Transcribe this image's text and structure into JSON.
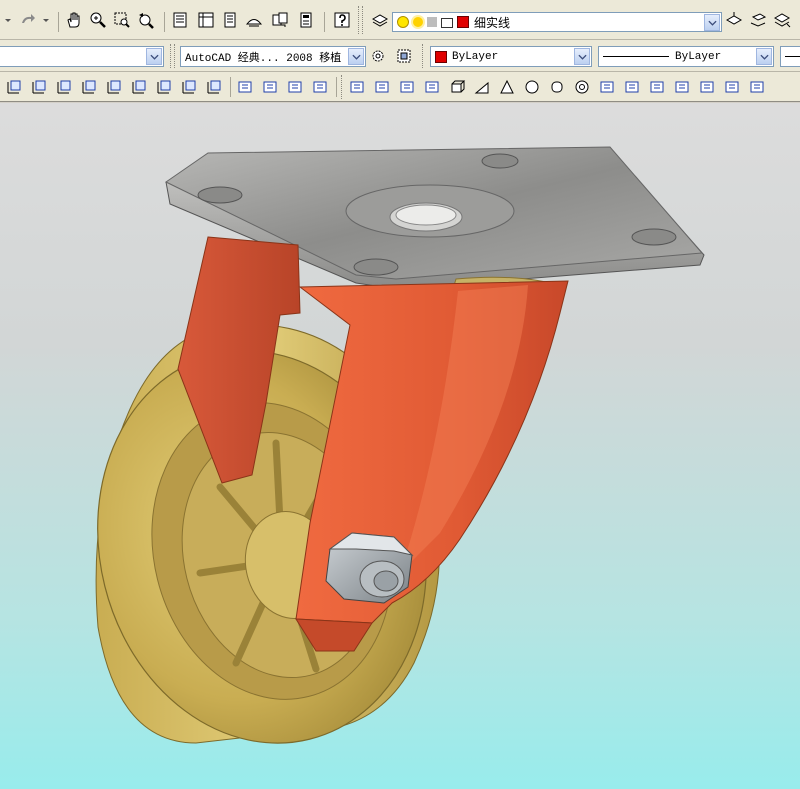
{
  "toolbar_row2": {
    "workspace_combo": "AutoCAD 经典... 2008 移植",
    "color_combo": "ByLayer",
    "linetype_combo": "ByLayer"
  },
  "toolbar_row1": {
    "layer_combo": "细实线"
  },
  "colors": {
    "layer_color": "#e00000",
    "bylayer_color": "#e00000",
    "fork_orange": "#e2613a",
    "wheel_gold": "#c9b156",
    "plate_gray": "#9a9a98"
  },
  "icons": {
    "row1": [
      "undo-dropdown-icon",
      "redo-icon",
      "redo-dropdown-icon",
      "pan-icon",
      "zoom-realtime-icon",
      "zoom-window-icon",
      "zoom-previous-icon",
      "properties-icon",
      "design-center-icon",
      "tool-palettes-icon",
      "markup-icon",
      "sheet-set-icon",
      "calculator-icon",
      "help-icon",
      "layer-manager-icon",
      "layer-on-icon",
      "layer-freeze-icon",
      "layer-lock-icon",
      "layer-previous-icon",
      "layer-make-current-icon"
    ],
    "row3": [
      "ucs-icon",
      "ucs-origin-icon",
      "ucs-object-icon",
      "ucs-x-icon",
      "ucs-y-icon",
      "ucs-z-icon",
      "ucs-face-icon",
      "ucs-3point-icon",
      "ucs-apply-icon",
      "shade-wireframe-icon",
      "shade-hidden-icon",
      "shade-flat-icon",
      "shade-gouraud-icon",
      "union-icon",
      "subtract-icon",
      "intersect-icon",
      "polysolid-icon",
      "box-icon",
      "wedge-icon",
      "cone-icon",
      "sphere-icon",
      "cylinder-icon",
      "torus-icon",
      "pyramid-icon",
      "helix-icon",
      "planar-surface-icon",
      "extrude-icon",
      "presspull-icon",
      "sweep-icon",
      "revolve-icon"
    ]
  }
}
